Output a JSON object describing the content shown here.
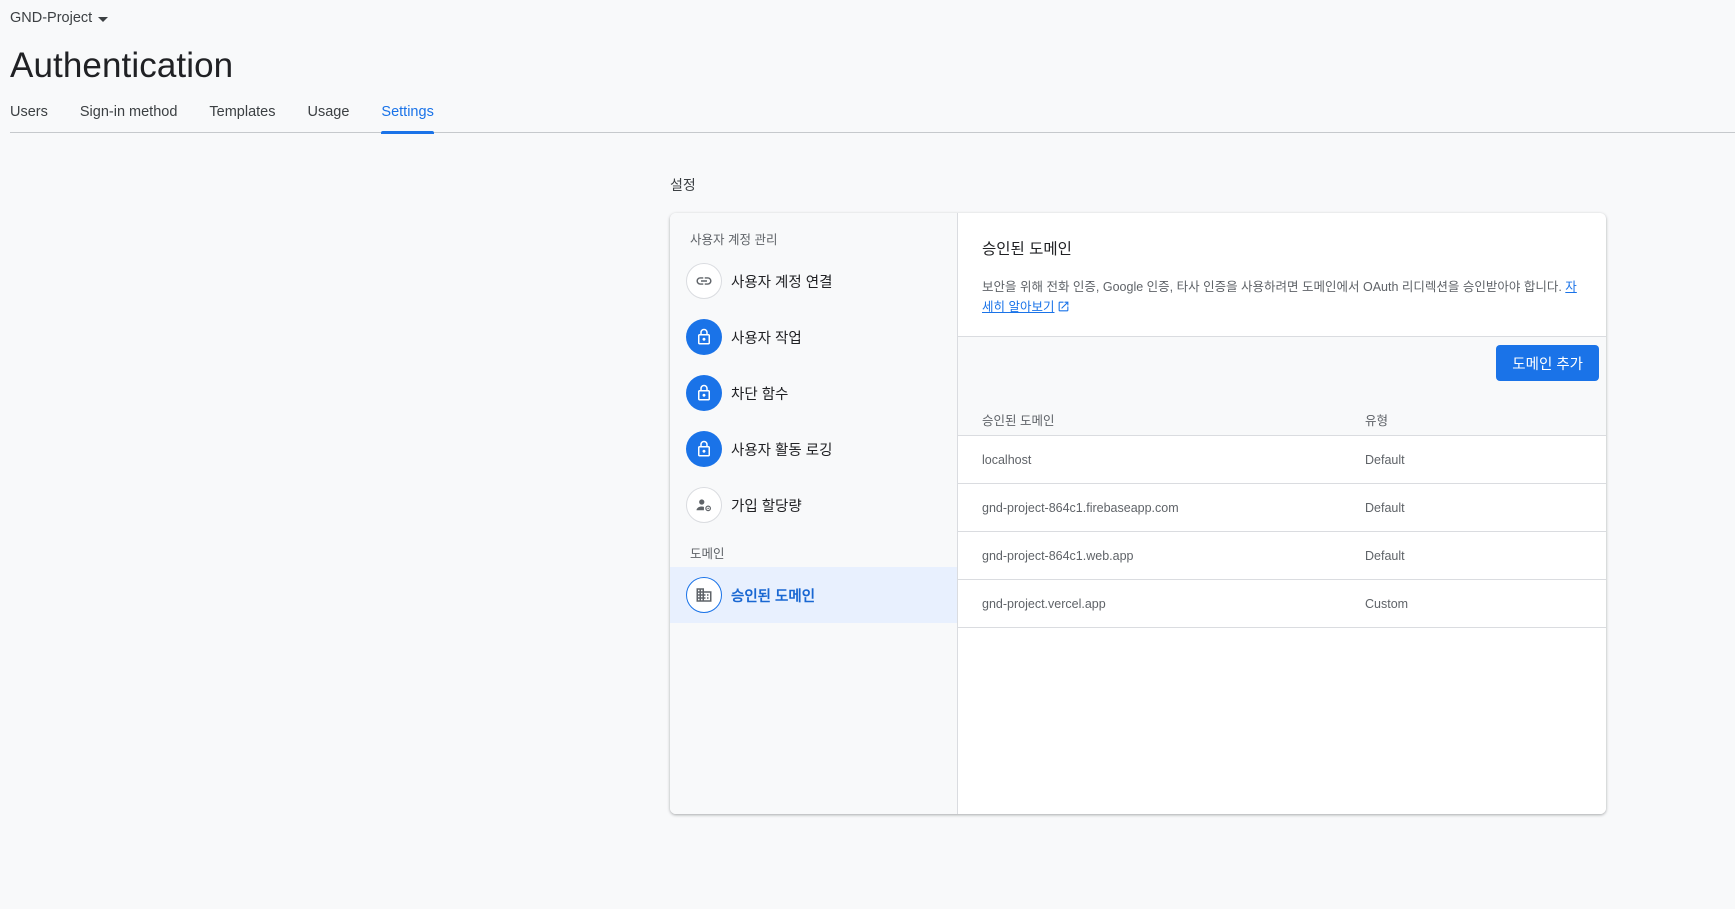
{
  "header": {
    "project_name": "GND-Project",
    "title": "Authentication"
  },
  "tabs": [
    {
      "label": "Users"
    },
    {
      "label": "Sign-in method"
    },
    {
      "label": "Templates"
    },
    {
      "label": "Usage"
    },
    {
      "label": "Settings",
      "active": true
    }
  ],
  "section_label": "설정",
  "sidebar": {
    "group1": "사용자 계정 관리",
    "items": [
      {
        "label": "사용자 계정 연결",
        "icon": "link-icon"
      },
      {
        "label": "사용자 작업",
        "icon": "lock-icon"
      },
      {
        "label": "차단 함수",
        "icon": "lock-icon"
      },
      {
        "label": "사용자 활동 로깅",
        "icon": "lock-icon"
      },
      {
        "label": "가입 할당량",
        "icon": "user-settings-icon"
      }
    ],
    "group2": "도메인",
    "domain_item": {
      "label": "승인된 도메인",
      "icon": "domain-icon",
      "active": true
    }
  },
  "main": {
    "title": "승인된 도메인",
    "description": "보안을 위해 전화 인증, Google 인증, 타사 인증을 사용하려면 도메인에서 OAuth 리디렉션을 승인받아야 합니다. ",
    "learn_more": "자세히 알아보기",
    "add_button": "도메인 추가",
    "columns": [
      "승인된 도메인",
      "유형"
    ],
    "rows": [
      {
        "domain": "localhost",
        "type": "Default"
      },
      {
        "domain": "gnd-project-864c1.firebaseapp.com",
        "type": "Default"
      },
      {
        "domain": "gnd-project-864c1.web.app",
        "type": "Default"
      },
      {
        "domain": "gnd-project.vercel.app",
        "type": "Custom"
      }
    ]
  },
  "colors": {
    "accent": "#1a73e8",
    "background": "#f8f9fa",
    "active_item_bg": "#e8f0fe"
  }
}
